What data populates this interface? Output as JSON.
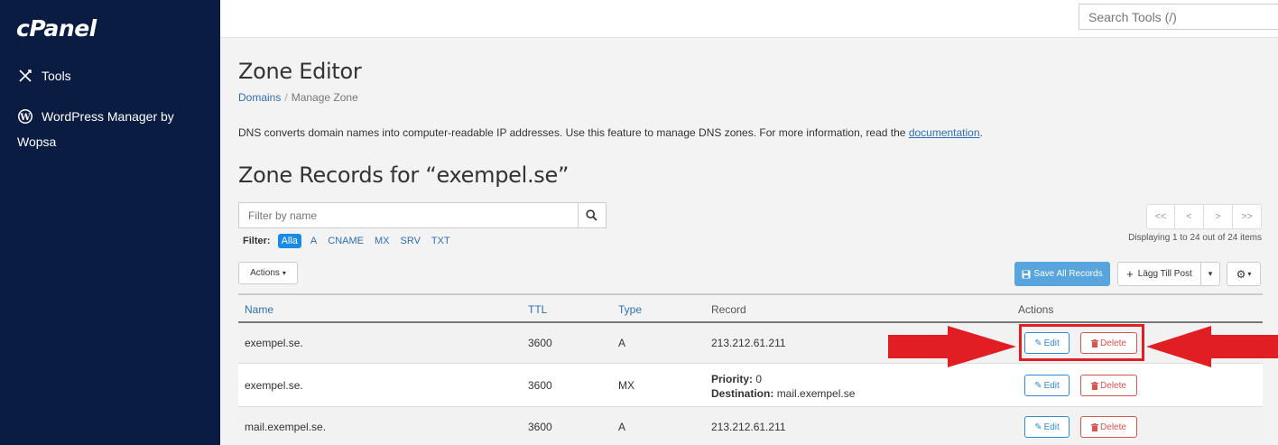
{
  "sidebar": {
    "logo": "cPanel",
    "items": [
      {
        "label": "Tools",
        "icon": "tools-icon"
      },
      {
        "label": "WordPress Manager by Wopsa",
        "line1": "WordPress Manager by",
        "line2": "Wopsa",
        "icon": "wordpress-icon"
      }
    ]
  },
  "topbar": {
    "search_placeholder": "Search Tools (/)"
  },
  "page": {
    "title": "Zone Editor",
    "breadcrumb": {
      "link": "Domains",
      "separator": "/",
      "current": "Manage Zone"
    },
    "description": "DNS converts domain names into computer-readable IP addresses. Use this feature to manage DNS zones. For more information, read the ",
    "description_link": "documentation",
    "description_end": ".",
    "zone_heading": "Zone Records for “exempel.se”"
  },
  "filter": {
    "placeholder": "Filter by name",
    "label": "Filter:",
    "options": [
      "Alla",
      "A",
      "CNAME",
      "MX",
      "SRV",
      "TXT"
    ],
    "selected": "Alla"
  },
  "pager": {
    "buttons": [
      "<<",
      "<",
      ">",
      ">>"
    ],
    "display_info": "Displaying 1 to 24 out of 24 items"
  },
  "toolbar": {
    "actions_label": "Actions",
    "save_all_label": "Save All Records",
    "add_label": "Lägg Till Post"
  },
  "table": {
    "headers": {
      "name": "Name",
      "ttl": "TTL",
      "type": "Type",
      "record": "Record",
      "actions": "Actions"
    },
    "rows": [
      {
        "name": "exempel.se.",
        "ttl": "3600",
        "type": "A",
        "record": "213.212.61.211"
      },
      {
        "name": "exempel.se.",
        "ttl": "3600",
        "type": "MX",
        "priority_label": "Priority:",
        "priority": "0",
        "destination_label": "Destination:",
        "destination": "mail.exempel.se"
      },
      {
        "name": "mail.exempel.se.",
        "ttl": "3600",
        "type": "A",
        "record": "213.212.61.211"
      }
    ],
    "edit_label": "Edit",
    "delete_label": "Delete"
  },
  "colors": {
    "sidebar_bg": "#0b1c42",
    "accent_blue": "#2f8bd6",
    "delete_red": "#d9534f",
    "annotation_red": "#e01e24"
  }
}
